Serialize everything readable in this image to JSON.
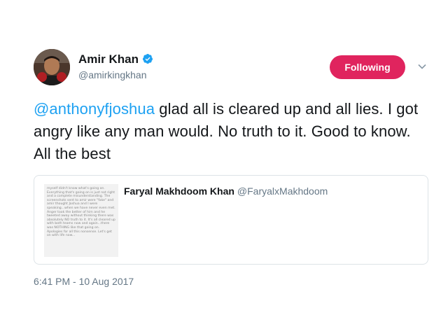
{
  "author": {
    "display_name": "Amir Khan",
    "handle": "@amirkingkhan",
    "verified_icon": "verified-badge-icon",
    "avatar_icon": "avatar"
  },
  "follow_button": {
    "label": "Following",
    "color": "#e0245e"
  },
  "menu": {
    "icon": "chevron-down-icon"
  },
  "tweet": {
    "mention": "@anthonyfjoshua",
    "text": " glad all is cleared up and all lies. I got angry like any man would. No truth to it. Good to know. All the best",
    "mention_color": "#1da1f2"
  },
  "quote": {
    "author_name": "Faryal Makhdoom Khan",
    "author_handle": "@FaryalxMakhdoom",
    "media_text": "myself didn't know what's going on. Everything that's going on is just not right and a complete misunderstanding. The screenshots sent to amir were \"fake\" and amir thought Joshua and I were speaking...when we have never even met. Anger took the better of him and he tweeted away without thinking there was absolutely NO truth to it. It's all cleared up with both teams now and again...there was NOTHING like that going on. Apologies for all this nonsense. Let's get on with life now..."
  },
  "timestamp": "6:41 PM - 10 Aug 2017"
}
